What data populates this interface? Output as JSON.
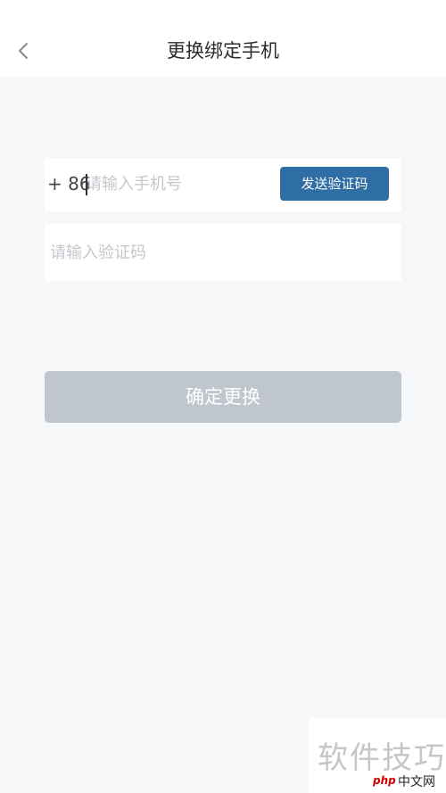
{
  "header": {
    "title": "更换绑定手机",
    "back_icon": "chevron-left-icon"
  },
  "form": {
    "country_code": "+ 86",
    "phone_placeholder": "请输入手机号",
    "send_code_label": "发送验证码",
    "code_placeholder": "请输入验证码"
  },
  "confirm": {
    "label": "确定更换"
  },
  "watermark": {
    "text": "软件技巧",
    "site_php": "php",
    "site_cn": "中文网"
  },
  "colors": {
    "primary": "#2f6ea4",
    "disabled": "#c0c6ce",
    "background": "#f6f7f9"
  }
}
